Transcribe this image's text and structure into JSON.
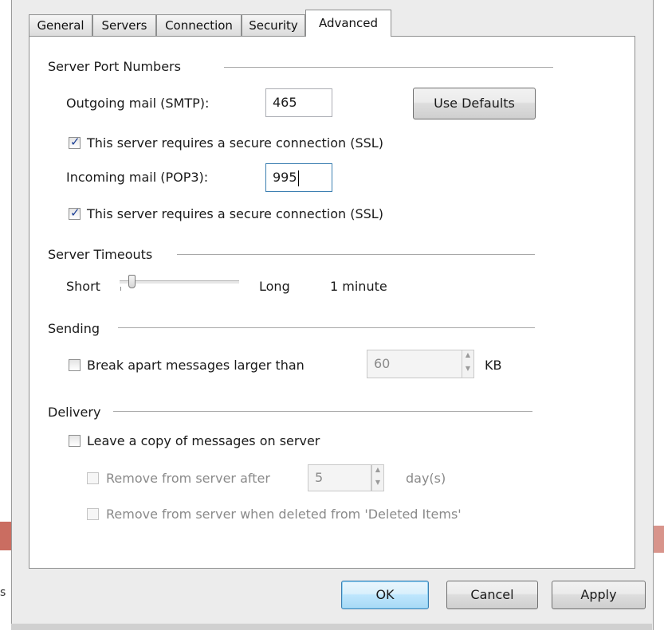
{
  "tabs": [
    "General",
    "Servers",
    "Connection",
    "Security",
    "Advanced"
  ],
  "server_ports": {
    "title": "Server Port Numbers",
    "outgoing_label": "Outgoing mail (SMTP):",
    "outgoing_value": "465",
    "use_defaults": "Use Defaults",
    "outgoing_ssl_label": "This server requires a secure connection (SSL)",
    "outgoing_ssl_checked": true,
    "incoming_label": "Incoming mail (POP3):",
    "incoming_value": "995",
    "incoming_ssl_label": "This server requires a secure connection (SSL)",
    "incoming_ssl_checked": true
  },
  "timeouts": {
    "title": "Server Timeouts",
    "short": "Short",
    "long": "Long",
    "value": "1 minute",
    "slider_fraction": 0.1
  },
  "sending": {
    "title": "Sending",
    "break_apart_label": "Break apart messages larger than",
    "break_apart_checked": false,
    "size_value": "60",
    "unit": "KB"
  },
  "delivery": {
    "title": "Delivery",
    "leave_copy_label": "Leave a copy of messages on server",
    "leave_copy_checked": false,
    "remove_after_label": "Remove from server after",
    "remove_after_value": "5",
    "days_unit": "day(s)",
    "remove_deleted_label": "Remove from server when deleted from 'Deleted Items'"
  },
  "buttons": {
    "ok": "OK",
    "cancel": "Cancel",
    "apply": "Apply"
  },
  "background": {
    "left_glyph": "s"
  }
}
